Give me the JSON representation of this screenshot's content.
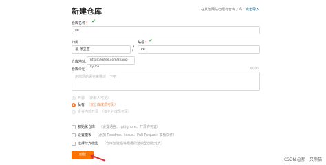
{
  "header": {
    "title": "新建仓库",
    "import_hint": "在其他网站已经有仓库了吗？",
    "import_link": "点击导入"
  },
  "form": {
    "repo_name_label": "仓库名称",
    "required_mark": "*",
    "repo_name_value": "ce",
    "owner_label": "归属",
    "owner_value": "张立艺",
    "path_label": "路径",
    "path_value": "ce",
    "address_label": "仓库地址:",
    "address_value": "https://gitee.com/zhang-liyi/ce",
    "intro_label": "仓库介绍",
    "intro_counter": "0/200",
    "intro_placeholder": "用简短的语言来描述一下吧"
  },
  "visibility": {
    "options": [
      {
        "label": "开源",
        "desc": "（所有人可见）",
        "state": "disabled"
      },
      {
        "label": "私有",
        "desc": "（仅仓库成员可见）",
        "state": "selected"
      },
      {
        "label": "企业内部开源",
        "desc": "（仅企业成员可见）",
        "state": "disabled"
      }
    ]
  },
  "options": [
    {
      "label": "初始化仓库",
      "desc": "（设置语言、.gitignore、开源许可证）"
    },
    {
      "label": "设置模板",
      "desc": "（添加 Readme、Issue、Pull Request 模板文件）"
    },
    {
      "label": "选择分支模型",
      "desc": "（仓库创建后将根据所选模型创建分支）"
    }
  ],
  "actions": {
    "create_label": "创建"
  },
  "watermark": "CSDN @那一只熊猫",
  "colors": {
    "accent": "#fe7300",
    "check": "#21a62c",
    "link": "#005980"
  }
}
